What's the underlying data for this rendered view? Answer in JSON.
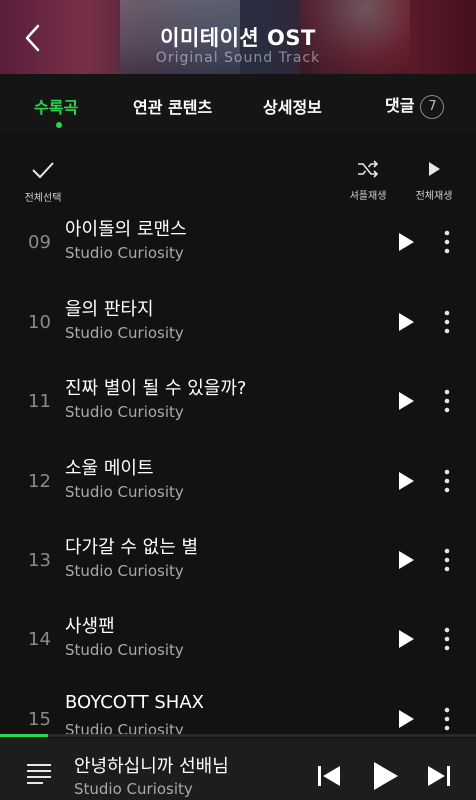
{
  "header": {
    "title": "이미테이션 OST",
    "subtitle": "Original Sound Track"
  },
  "tabs": [
    {
      "label": "수록곡",
      "active": true
    },
    {
      "label": "연관 콘텐츠",
      "active": false
    },
    {
      "label": "상세정보",
      "active": false
    },
    {
      "label": "댓글",
      "active": false,
      "count": "7"
    }
  ],
  "actions": {
    "select_all": "전체선택",
    "shuffle": "셔플재생",
    "play_all": "전체재생"
  },
  "tracks": [
    {
      "num": "09",
      "title": "아이돌의 로맨스",
      "artist": "Studio Curiosity"
    },
    {
      "num": "10",
      "title": "을의 판타지",
      "artist": "Studio Curiosity"
    },
    {
      "num": "11",
      "title": "진짜 별이 될 수 있을까?",
      "artist": "Studio Curiosity"
    },
    {
      "num": "12",
      "title": "소울 메이트",
      "artist": "Studio Curiosity"
    },
    {
      "num": "13",
      "title": "다가갈 수 없는 별",
      "artist": "Studio Curiosity"
    },
    {
      "num": "14",
      "title": "사생팬",
      "artist": "Studio Curiosity"
    },
    {
      "num": "15",
      "title": "BOYCOTT SHAX",
      "artist": "Studio Curiosity"
    }
  ],
  "player": {
    "title": "안녕하십니까 선배님",
    "artist": "Studio Curiosity",
    "progress": 0.1
  },
  "colors": {
    "accent": "#2bd64a",
    "background": "#121212",
    "secondary_text": "#a9a9a9"
  },
  "icons": [
    "back-icon",
    "check-icon",
    "shuffle-icon",
    "play-icon",
    "more-vertical-icon",
    "playlist-icon",
    "previous-icon",
    "next-icon"
  ]
}
